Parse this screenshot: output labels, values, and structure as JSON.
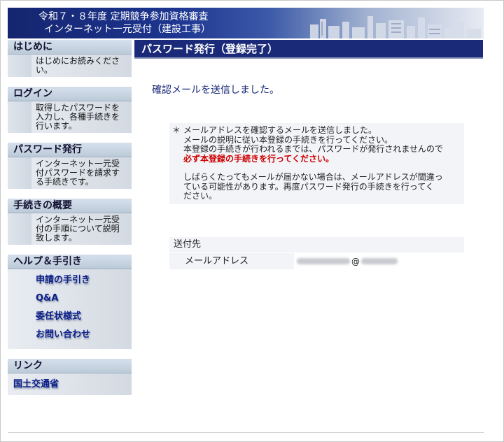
{
  "header": {
    "line1": "令和７・８年度 定期競争参加資格審査",
    "line2": "インターネット一元受付（建設工事）"
  },
  "sidebar": {
    "intro": {
      "title": "はじめに",
      "desc": "はじめにお読みください。"
    },
    "login": {
      "title": "ログイン",
      "desc": "取得したパスワードを入力し、各種手続きを行います。"
    },
    "password": {
      "title": "パスワード発行",
      "desc": "インターネット一元受付パスワードを請求する手続きです。"
    },
    "overview": {
      "title": "手続きの概要",
      "desc": "インターネット一元受付の手順について説明致します。"
    },
    "help": {
      "title": "ヘルプ＆手引き",
      "items": [
        "申請の手引き",
        "Q&A",
        "委任状様式",
        "お問い合わせ"
      ]
    },
    "links": {
      "title": "リンク",
      "items": [
        "国土交通省"
      ]
    }
  },
  "main": {
    "heading": "パスワード発行（登録完了）",
    "confirm": "確認メールを送信しました。",
    "notice": {
      "star": "＊",
      "p1_l1": "メールアドレスを確認するメールを送信しました。",
      "p1_l2": "メールの説明に従い本登録の手続きを行ってください。",
      "p1_l3": "本登録の手続きが行われるまでは、パスワードが発行されませんので",
      "p1_emph": "必ず本登録の手続きを行ってください。",
      "p2_l1": "しばらくたってもメールが届かない場合は、メールアドレスが間違っ",
      "p2_l2": "ている可能性があります。再度パスワード発行の手続きを行ってく",
      "p2_l3": "ださい。"
    },
    "destination": {
      "title": "送付先",
      "label": "メールアドレス",
      "at": "@"
    }
  }
}
